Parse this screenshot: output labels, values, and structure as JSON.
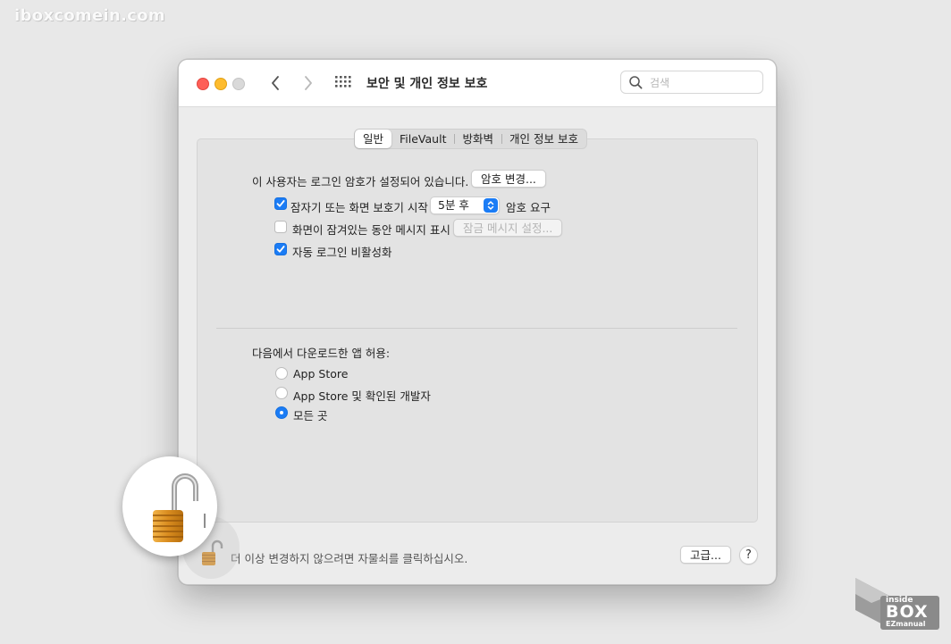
{
  "watermark": "iboxcomein.com",
  "window": {
    "title": "보안 및 개인 정보 보호",
    "search_placeholder": "검색"
  },
  "tabs": [
    {
      "label": "일반",
      "active": true
    },
    {
      "label": "FileVault",
      "active": false
    },
    {
      "label": "방화벽",
      "active": false
    },
    {
      "label": "개인 정보 보호",
      "active": false
    }
  ],
  "general": {
    "password_status": "이 사용자는 로그인 암호가 설정되어 있습니다.",
    "change_password_button": "암호 변경...",
    "require_password": {
      "checked": true,
      "label_before": "잠자기 또는 화면 보호기 시작",
      "selected_option": "5분 후",
      "label_after": "암호 요구"
    },
    "show_message": {
      "checked": false,
      "label": "화면이 잠겨있는 동안 메시지 표시",
      "button": "잠금 메시지 설정..."
    },
    "disable_auto_login": {
      "checked": true,
      "label": "자동 로그인 비활성화"
    }
  },
  "downloads": {
    "heading": "다음에서 다운로드한 앱 허용:",
    "options": [
      {
        "label": "App Store",
        "selected": false
      },
      {
        "label": "App Store 및 확인된 개발자",
        "selected": false
      },
      {
        "label": "모든 곳",
        "selected": true
      }
    ]
  },
  "footer": {
    "lock_message": "더 이상 변경하지 않으려면 자물쇠를 클릭하십시오.",
    "advanced_button": "고급...",
    "help_button": "?"
  },
  "logo": {
    "line1": "inside",
    "line2": "BOX",
    "line3": "EZmanual"
  },
  "colors": {
    "accent": "#1b7cf5",
    "close": "#fe5f57",
    "minimize": "#febc2e",
    "zoom_disabled": "#d9d9d9",
    "lock_gold": "#d98c1f"
  },
  "icons": [
    "back-chevron-icon",
    "forward-chevron-icon",
    "grid-icon",
    "search-icon",
    "checkmark-icon",
    "stepper-icon",
    "unlocked-padlock-icon",
    "help-icon"
  ]
}
